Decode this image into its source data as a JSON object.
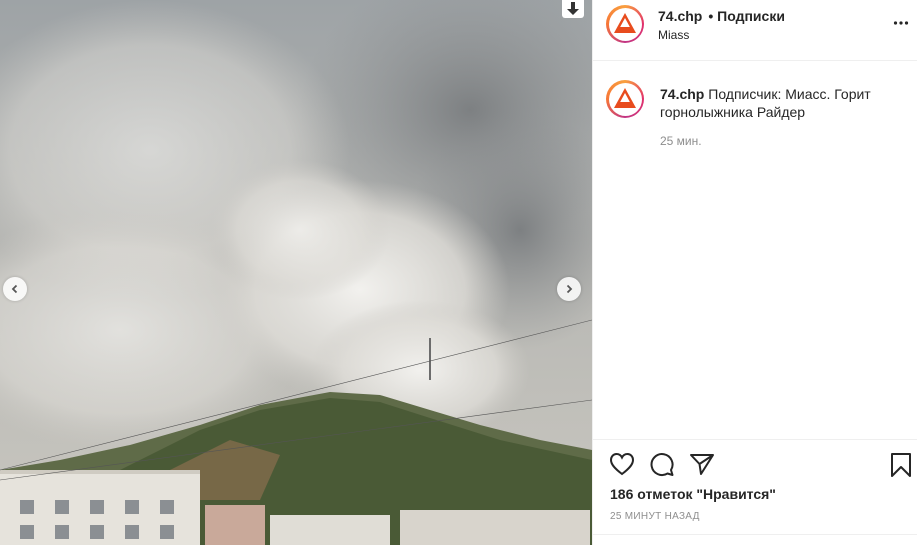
{
  "photo": {
    "alt_icon": "download-arrow-icon",
    "prev_icon": "chevron-left-icon",
    "next_icon": "chevron-right-icon"
  },
  "header": {
    "username": "74.chp",
    "separator": "•",
    "follow_label": "Подписки",
    "location": "Miass",
    "more_icon": "more-options-icon"
  },
  "comment": {
    "username": "74.chp",
    "text": "Подписчик: Миасс. Горит горнолыжника Райдер",
    "time": "25 мин."
  },
  "actions": {
    "like_icon": "heart-icon",
    "comment_icon": "comment-icon",
    "share_icon": "share-icon",
    "save_icon": "bookmark-icon",
    "likes_text": "186 отметок \"Нравится\"",
    "posted_time": "25 МИНУТ НАЗАД"
  },
  "colors": {
    "text": "#262626",
    "muted": "#8e8e8e",
    "border": "#efefef"
  }
}
